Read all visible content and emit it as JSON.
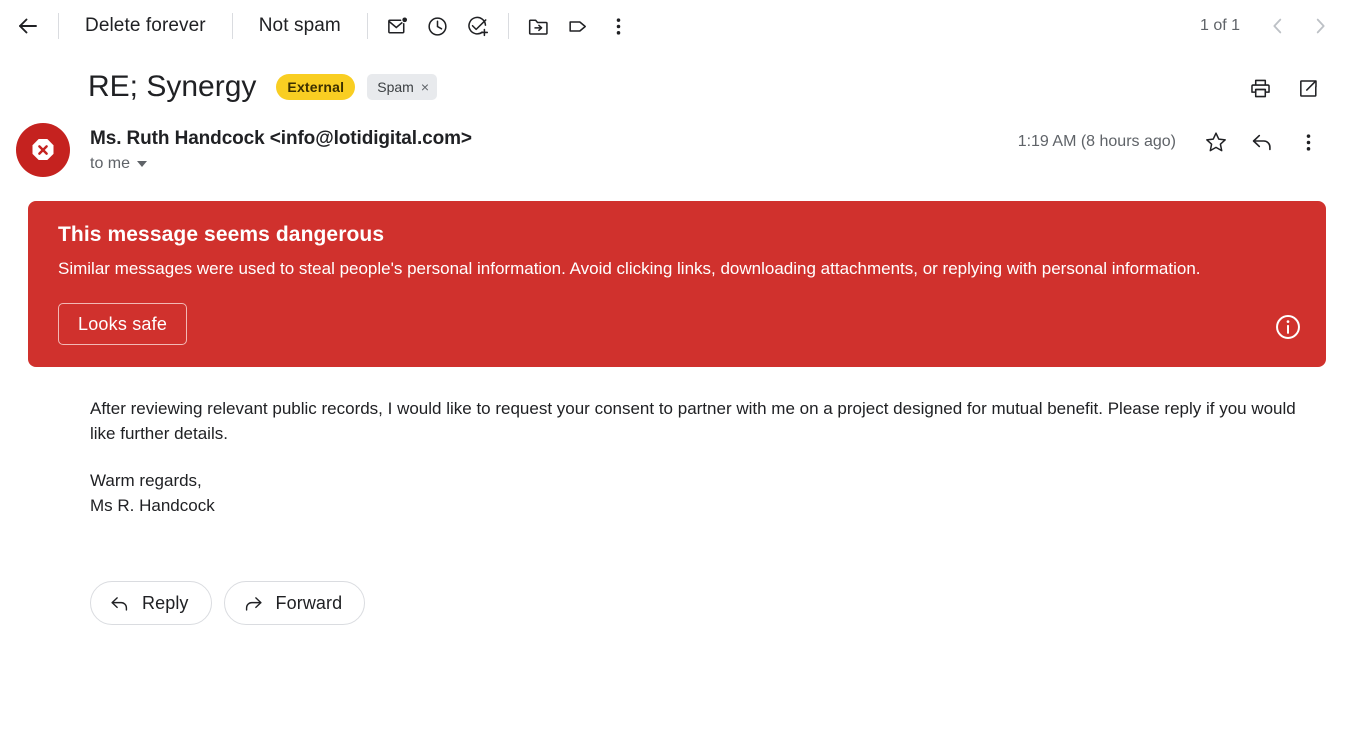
{
  "toolbar": {
    "back_label": "back-arrow",
    "delete_forever": "Delete forever",
    "not_spam": "Not spam",
    "mark_unread": "mark-as-unread",
    "snooze": "snooze",
    "add_to_tasks": "add-to-tasks",
    "move_to": "move-to",
    "labels": "labels",
    "more": "more-options",
    "page_count": "1 of 1",
    "prev": "newer",
    "next": "older"
  },
  "subject": {
    "title": "RE; Synergy",
    "badge_external": "External",
    "chip_spam": "Spam",
    "chip_spam_remove": "×",
    "print_label": "print-all",
    "popout_label": "open-in-new-window"
  },
  "sender": {
    "name": "Ms. Ruth Handcock <info@lotidigital.com>",
    "to": "to me",
    "timestamp": "1:19 AM (8 hours ago)",
    "star_label": "star",
    "reply_label": "reply",
    "more_label": "more-options"
  },
  "danger": {
    "title": "This message seems dangerous",
    "description": "Similar messages were used to steal people's personal information. Avoid clicking links, downloading attachments, or replying with personal information.",
    "looks_safe_label": "Looks safe",
    "info_label": "more-info",
    "color": "#d0312d"
  },
  "body": {
    "paragraph1": "After reviewing relevant public records, I would like to request your consent to partner with me on a project designed for mutual benefit. Please reply if you would like further details.",
    "signoff": "Warm regards,",
    "signature": "Ms R. Handcock"
  },
  "actions": {
    "reply": "Reply",
    "forward": "Forward"
  },
  "colors": {
    "danger_red": "#d0312d",
    "avatar_red": "#c5221f",
    "external_yellow": "#f9ce22",
    "chip_gray": "#e8eaed"
  }
}
